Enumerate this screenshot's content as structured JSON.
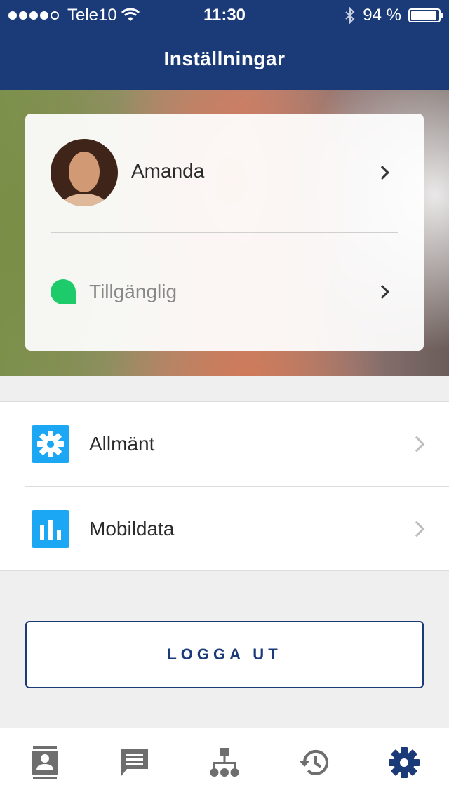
{
  "status_bar": {
    "carrier": "Tele10",
    "time": "11:30",
    "battery_percent": "94 %",
    "battery_level": 0.94
  },
  "header": {
    "title": "Inställningar"
  },
  "profile": {
    "name": "Amanda",
    "presence": "Tillgänglig",
    "presence_color": "#1ecb6a"
  },
  "settings": {
    "items": [
      {
        "label": "Allmänt",
        "icon": "gear-icon"
      },
      {
        "label": "Mobildata",
        "icon": "bar-chart-icon"
      }
    ]
  },
  "logout": {
    "label": "LOGGA UT"
  },
  "tabs": [
    {
      "icon": "contacts-icon"
    },
    {
      "icon": "chat-icon"
    },
    {
      "icon": "org-chart-icon"
    },
    {
      "icon": "history-icon"
    },
    {
      "icon": "settings-gear-icon",
      "active": true
    }
  ],
  "colors": {
    "brand": "#1a3a78",
    "accent": "#1ba7f3",
    "tab_inactive": "#6e6e6e"
  }
}
